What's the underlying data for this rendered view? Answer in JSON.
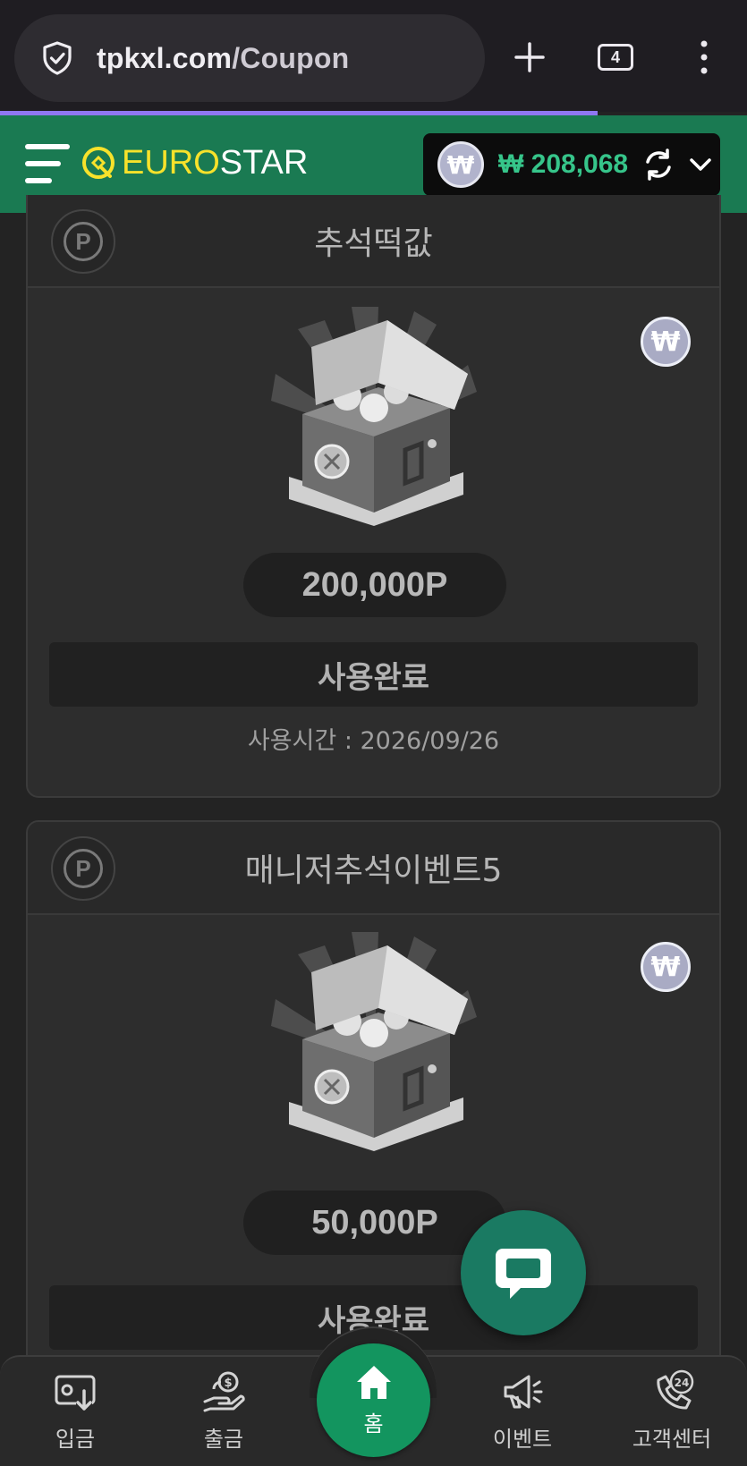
{
  "browser": {
    "url_domain": "tpkxl.com",
    "url_path": "/Coupon",
    "tab_count": "4"
  },
  "header": {
    "logo_euro": "EURO",
    "logo_star": "STAR",
    "currency_symbol": "₩",
    "balance": "₩ 208,068"
  },
  "coupons": [
    {
      "title": "추석떡값",
      "badge": "P",
      "currency_badge": "₩",
      "amount": "200,000P",
      "status": "사용완료",
      "used_time": "사용시간 : 2026/09/26"
    },
    {
      "title": "매니저추석이벤트5",
      "badge": "P",
      "currency_badge": "₩",
      "amount": "50,000P",
      "status": "사용완료"
    }
  ],
  "bottom_nav": {
    "deposit": "입금",
    "withdraw": "출금",
    "home": "홈",
    "event": "이벤트",
    "support": "고객센터",
    "support_badge": "24"
  },
  "colors": {
    "header_green": "#1a7a52",
    "balance_green": "#36c58a",
    "logo_yellow": "#f7e22b",
    "progress": "#8f77f2",
    "home_green": "#13955f"
  }
}
